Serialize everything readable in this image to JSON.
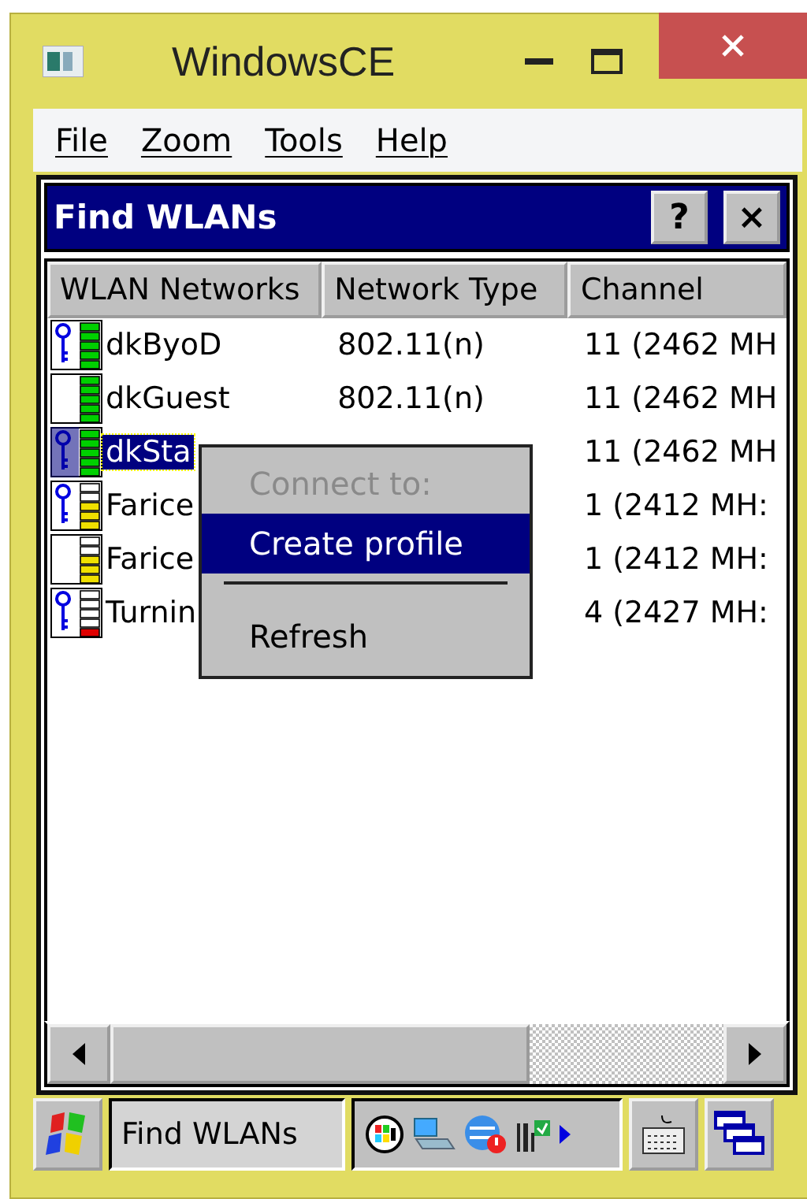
{
  "window": {
    "title": "WindowsCE"
  },
  "menu": [
    "File",
    "Zoom",
    "Tools",
    "Help"
  ],
  "dialog": {
    "title": "Find WLANs",
    "help_button": "?",
    "close_button": "×"
  },
  "table": {
    "columns": [
      "WLAN Networks",
      "Network Type",
      "Channel"
    ],
    "rows": [
      {
        "name": "dkByoD",
        "type": "802.11(n)",
        "channel": "11 (2462 MH",
        "secured": true,
        "kind": "strong",
        "color": "#00d000",
        "selected": false
      },
      {
        "name": "dkGuest",
        "type": "802.11(n)",
        "channel": "11 (2462 MH",
        "secured": false,
        "kind": "strong",
        "color": "#00d000",
        "selected": false
      },
      {
        "name": "dkSta",
        "channel": "11 (2462 MH",
        "secured": true,
        "kind": "strong",
        "color": "#00d000",
        "selected": true
      },
      {
        "name": "Farice",
        "channel": "1 (2412 MH:",
        "secured": true,
        "kind": "medium",
        "color": "#f0e000",
        "selected": false
      },
      {
        "name": "Farice",
        "channel": "1 (2412 MH:",
        "secured": false,
        "kind": "medium",
        "color": "#f0e000",
        "selected": false
      },
      {
        "name": "Turnin",
        "channel": "4 (2427 MH:",
        "secured": true,
        "kind": "weak",
        "color": "#e00000",
        "selected": false
      }
    ]
  },
  "context_menu": [
    {
      "kind": "item",
      "label": "Connect to:",
      "disabled": true,
      "selected": false
    },
    {
      "kind": "item",
      "label": "Create profile",
      "disabled": false,
      "selected": true
    },
    {
      "kind": "separator"
    },
    {
      "kind": "item",
      "label": "Refresh",
      "disabled": false,
      "selected": false
    }
  ],
  "taskbar": {
    "task": "Find WLANs"
  }
}
